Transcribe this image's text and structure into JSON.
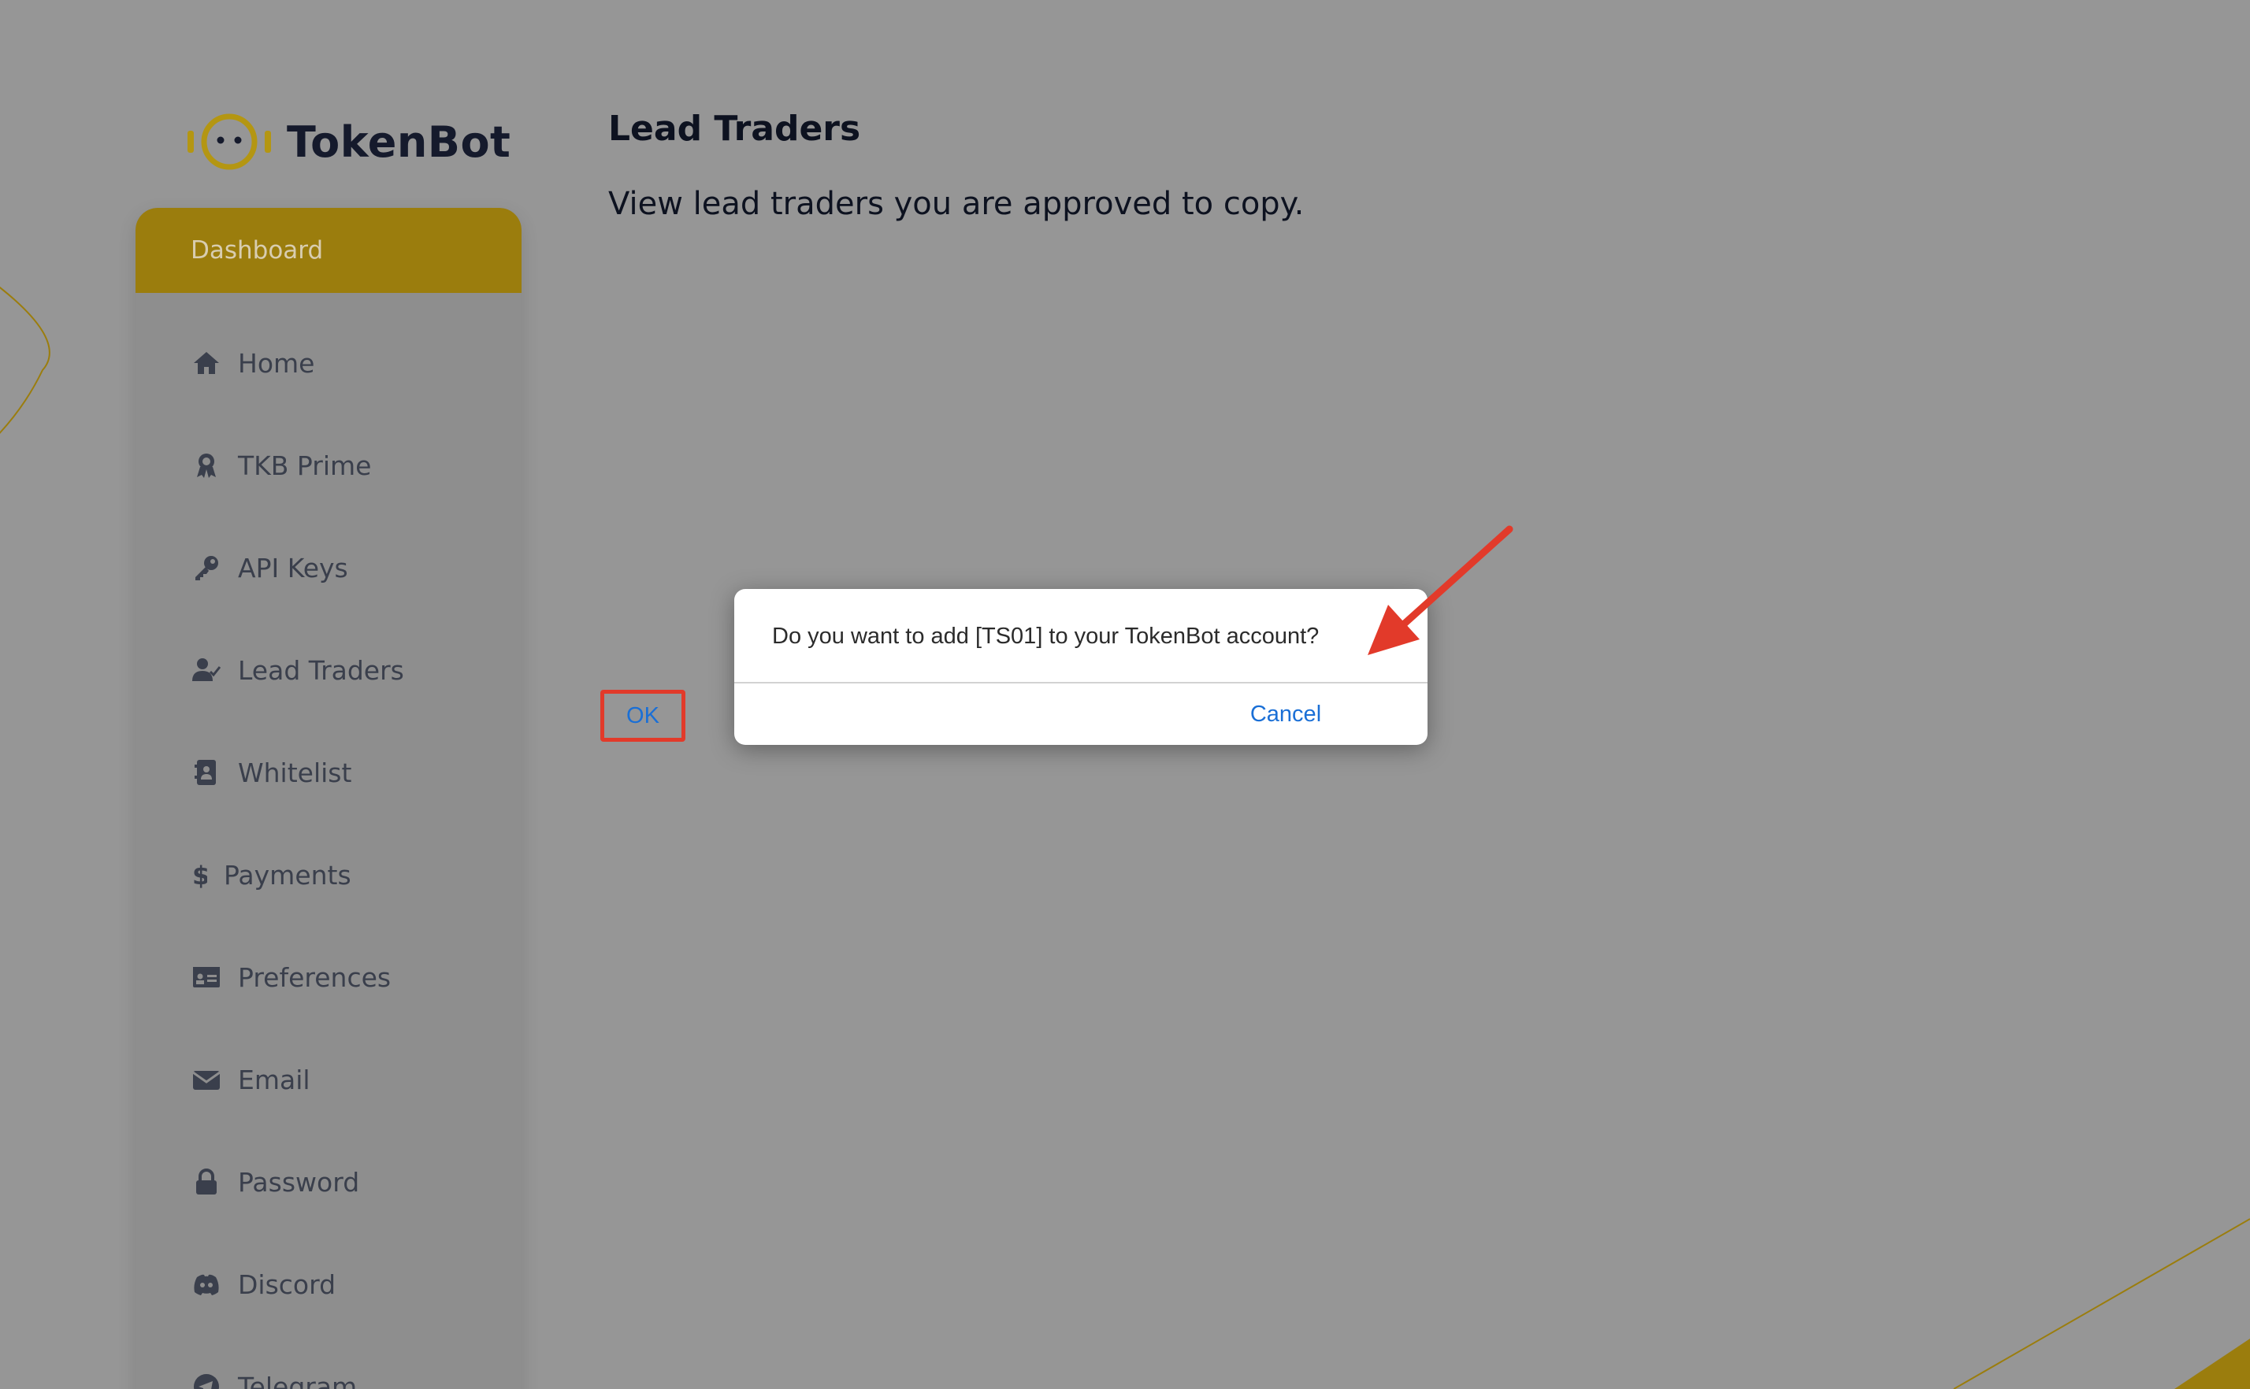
{
  "app": {
    "brand": "TokenBot"
  },
  "sidebar": {
    "header_label": "Dashboard",
    "items": [
      {
        "label": "Home",
        "icon": "home-icon"
      },
      {
        "label": "TKB Prime",
        "icon": "award-icon"
      },
      {
        "label": "API Keys",
        "icon": "key-icon"
      },
      {
        "label": "Lead Traders",
        "icon": "user-check-icon"
      },
      {
        "label": "Whitelist",
        "icon": "address-book-icon"
      },
      {
        "label": "Payments",
        "icon": "dollar-icon"
      },
      {
        "label": "Preferences",
        "icon": "id-card-icon"
      },
      {
        "label": "Email",
        "icon": "envelope-icon"
      },
      {
        "label": "Password",
        "icon": "lock-icon"
      },
      {
        "label": "Discord",
        "icon": "discord-icon"
      },
      {
        "label": "Telegram",
        "icon": "telegram-icon"
      }
    ]
  },
  "main": {
    "title": "Lead Traders",
    "subtitle": "View lead traders you are approved to copy."
  },
  "dialog": {
    "message": "Do you want to add [TS01] to your TokenBot account?",
    "cancel_label": "Cancel",
    "ok_label": "OK"
  },
  "colors": {
    "accent": "#9b7d0d",
    "overlay_bg": "#969696",
    "link_blue": "#1a6fd6",
    "annotation_red": "#e23a2a"
  }
}
